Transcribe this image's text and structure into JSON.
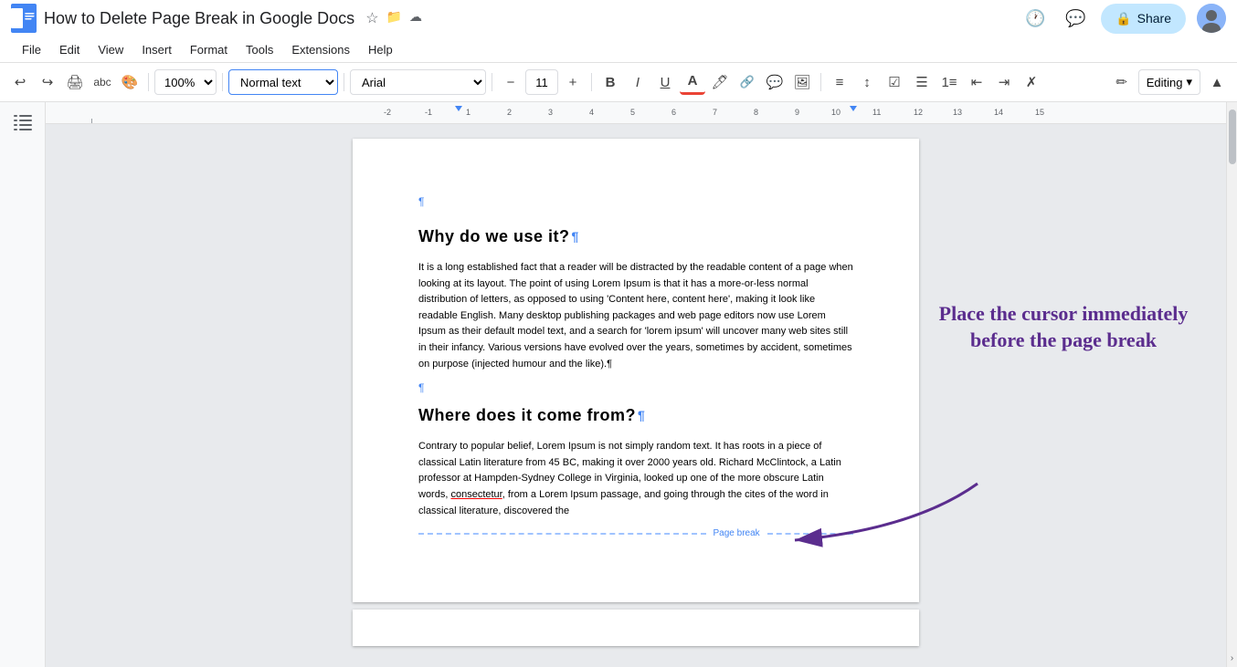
{
  "titleBar": {
    "title": "How to Delete Page Break in Google Docs",
    "starIcon": "★",
    "folderIcon": "⬛",
    "cloudIcon": "☁",
    "shareLabel": "Share",
    "historyIcon": "🕐",
    "commentIcon": "💬"
  },
  "menuBar": {
    "items": [
      "File",
      "Edit",
      "View",
      "Insert",
      "Format",
      "Tools",
      "Extensions",
      "Help"
    ]
  },
  "toolbar": {
    "undoIcon": "↩",
    "redoIcon": "↪",
    "printIcon": "🖨",
    "paintIcon": "🎨",
    "zoomLabel": "100%",
    "styleLabel": "Normal text",
    "fontLabel": "Arial",
    "fontSizeLabel": "11",
    "boldLabel": "B",
    "italicLabel": "I",
    "underlineLabel": "U",
    "editingLabel": "Editing",
    "decreaseFontIcon": "−",
    "increaseFontIcon": "+"
  },
  "document": {
    "heading1": "Why do we use it?",
    "paragraph1": "It is a long established fact that a reader will be distracted by the readable content of a page when looking at its layout. The point of using Lorem Ipsum is that it has a more-or-less normal distribution of letters, as opposed to using 'Content here, content here', making it look like readable English. Many desktop publishing packages and web page editors now use Lorem Ipsum as their default model text, and a search for 'lorem ipsum' will uncover many web sites still in their infancy. Various versions have evolved over the years, sometimes by accident, sometimes on purpose (injected humour and the like).¶",
    "heading2": "Where does it come from?",
    "paragraph2": "Contrary to popular belief, Lorem Ipsum is not simply random text. It has roots in a piece of classical Latin literature from 45 BC, making it over 2000 years old. Richard McClintock, a Latin professor at Hampden-Sydney College in Virginia, looked up one of the more obscure Latin words, consectetur, from a Lorem Ipsum passage, and going through the cites of the word in classical literature, discovered the",
    "pageBreakLabel": "Page break"
  },
  "annotation": {
    "text": "Place the cursor immediately before the page break",
    "color": "#5b2d8e"
  }
}
